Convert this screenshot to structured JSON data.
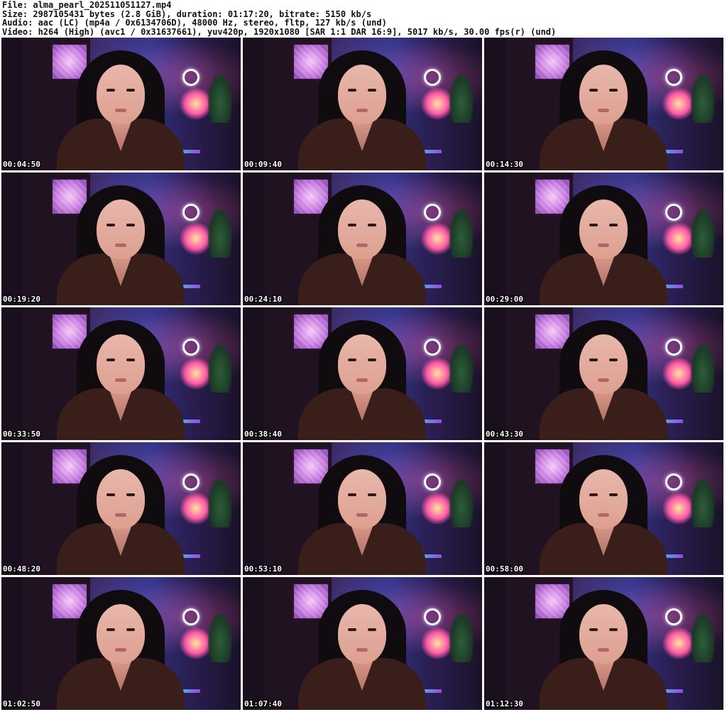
{
  "header": {
    "lines": [
      "File: alma_pearl_202511051127.mp4",
      "Size: 2987105431 bytes (2.8 GiB), duration: 01:17:20, bitrate: 5150 kb/s",
      "Audio: aac (LC) (mp4a / 0x6134706D), 48000 Hz, stereo, fltp, 127 kb/s (und)",
      "Video: h264 (High) (avc1 / 0x31637661), yuv420p, 1920x1080 [SAR 1:1 DAR 16:9], 5017 kb/s, 30.00 fps(r) (und)"
    ]
  },
  "thumbnails": [
    {
      "timestamp": "00:04:50"
    },
    {
      "timestamp": "00:09:40"
    },
    {
      "timestamp": "00:14:30"
    },
    {
      "timestamp": "00:19:20"
    },
    {
      "timestamp": "00:24:10"
    },
    {
      "timestamp": "00:29:00"
    },
    {
      "timestamp": "00:33:50"
    },
    {
      "timestamp": "00:38:40"
    },
    {
      "timestamp": "00:43:30"
    },
    {
      "timestamp": "00:48:20"
    },
    {
      "timestamp": "00:53:10"
    },
    {
      "timestamp": "00:58:00"
    },
    {
      "timestamp": "01:02:50"
    },
    {
      "timestamp": "01:07:40"
    },
    {
      "timestamp": "01:12:30"
    }
  ]
}
